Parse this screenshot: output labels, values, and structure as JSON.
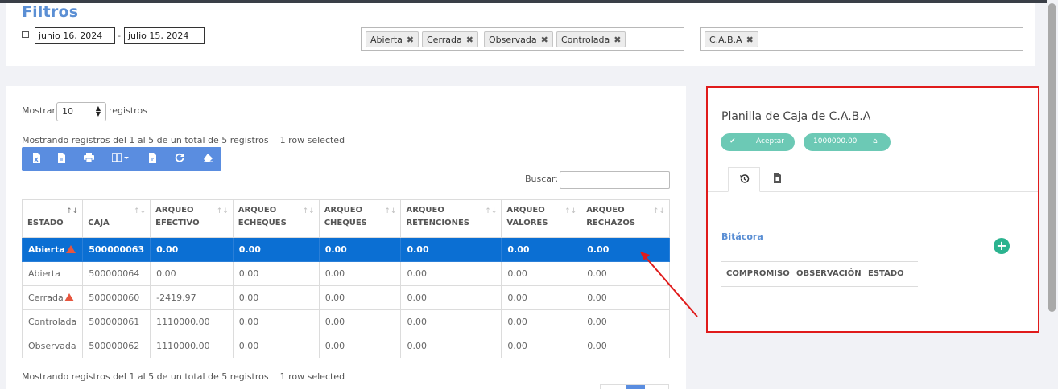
{
  "filters": {
    "title": "Filtros",
    "date_from": "junio 16, 2024",
    "date_to": "julio 15, 2024",
    "date_separator": "-",
    "status_tags": [
      "Abierta",
      "Cerrada",
      "Observada",
      "Controlada"
    ],
    "region_tags": [
      "C.A.B.A"
    ],
    "tag_remove_glyph": "✖"
  },
  "table_controls": {
    "show_label": "Mostrar",
    "page_size": "10",
    "records_label": "registros",
    "info_top": "Mostrando registros del 1 al 5 de un total de 5 registros",
    "selected_top": "1 row selected",
    "info_bottom": "Mostrando registros del 1 al 5 de un total de 5 registros",
    "selected_bottom": "1 row selected",
    "search_label": "Buscar:",
    "search_value": ""
  },
  "toolbar_icons": [
    "excel-icon",
    "csv-icon",
    "print-icon",
    "columns-icon",
    "pdf-icon",
    "refresh-icon",
    "eraser-icon"
  ],
  "table": {
    "headers": [
      [
        "ESTADO",
        ""
      ],
      [
        "CAJA",
        ""
      ],
      [
        "ARQUEO",
        "EFECTIVO"
      ],
      [
        "ARQUEO",
        "ECHEQUES"
      ],
      [
        "ARQUEO",
        "CHEQUES"
      ],
      [
        "ARQUEO",
        "RETENCIONES"
      ],
      [
        "ARQUEO",
        "VALORES"
      ],
      [
        "ARQUEO",
        "RECHAZOS"
      ]
    ],
    "rows": [
      {
        "estado": "Abierta",
        "warning": true,
        "selected": true,
        "caja": "500000063",
        "efectivo": "0.00",
        "echeques": "0.00",
        "cheques": "0.00",
        "retenciones": "0.00",
        "valores": "0.00",
        "rechazos": "0.00"
      },
      {
        "estado": "Abierta",
        "warning": false,
        "selected": false,
        "caja": "500000064",
        "efectivo": "0.00",
        "echeques": "0.00",
        "cheques": "0.00",
        "retenciones": "0.00",
        "valores": "0.00",
        "rechazos": "0.00"
      },
      {
        "estado": "Cerrada",
        "warning": true,
        "selected": false,
        "caja": "500000060",
        "efectivo": "-2419.97",
        "echeques": "0.00",
        "cheques": "0.00",
        "retenciones": "0.00",
        "valores": "0.00",
        "rechazos": "0.00"
      },
      {
        "estado": "Controlada",
        "warning": false,
        "selected": false,
        "caja": "500000061",
        "efectivo": "1110000.00",
        "echeques": "0.00",
        "cheques": "0.00",
        "retenciones": "0.00",
        "valores": "0.00",
        "rechazos": "0.00"
      },
      {
        "estado": "Observada",
        "warning": false,
        "selected": false,
        "caja": "500000062",
        "efectivo": "1110000.00",
        "echeques": "0.00",
        "cheques": "0.00",
        "retenciones": "0.00",
        "valores": "0.00",
        "rechazos": "0.00"
      }
    ]
  },
  "side_panel": {
    "title": "Planilla de Caja de C.A.B.A",
    "accept_label": "Aceptar",
    "amount_label": "1000000.00",
    "tabs": [
      "history-icon",
      "document-icon"
    ],
    "section_title": "Bitácora",
    "add_glyph": "+",
    "columns": [
      "COMPROMISO",
      "OBSERVACIÓN",
      "ESTADO"
    ]
  },
  "colors": {
    "accent": "#5a8de0",
    "selected_row": "#0b6fd3",
    "highlight_border": "#e01b1b",
    "teal": "#6cc9b5",
    "warning": "#e6563f"
  }
}
